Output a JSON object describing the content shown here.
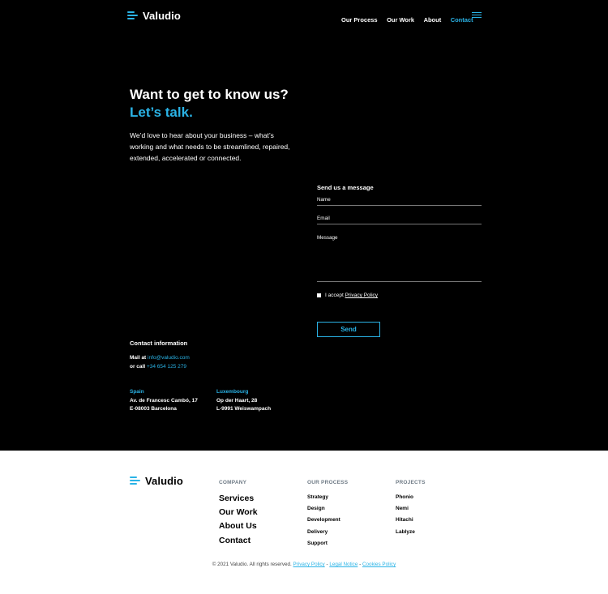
{
  "brand": {
    "name": "Valudio",
    "accent": "#2ab3e6"
  },
  "nav": {
    "items": [
      {
        "label": "Our Process"
      },
      {
        "label": "Our Work"
      },
      {
        "label": "About"
      },
      {
        "label": "Contact"
      }
    ],
    "menu_icon": "hamburger-icon"
  },
  "hero": {
    "title": "Want to get to know us?",
    "subtitle": "Let’s talk.",
    "intro": "We’d love to hear about your business – what’s working and what needs to be streamlined, repaired, extended, accelerated or connected."
  },
  "form": {
    "title": "Send us a message",
    "name_label": "Name",
    "email_label": "Email",
    "message_label": "Message",
    "accept_text": "I accept",
    "privacy_link": "Privacy Policy",
    "send_label": "Send"
  },
  "contact": {
    "heading": "Contact information",
    "mail_prefix": "Mail at",
    "email": "info@valudio.com",
    "call_prefix": "or call",
    "phone": "+34 654 125 279",
    "offices": [
      {
        "country": "Spain",
        "line1": "Av. de Francesc Cambó, 17",
        "line2": "E-08003 Barcelona"
      },
      {
        "country": "Luxembourg",
        "line1": "Op der Haart, 28",
        "line2": "L-9991 Weiswampach"
      }
    ]
  },
  "footer": {
    "company": {
      "heading": "COMPANY",
      "items": [
        "Services",
        "Our Work",
        "About Us",
        "Contact"
      ]
    },
    "process": {
      "heading": "OUR PROCESS",
      "items": [
        "Strategy",
        "Design",
        "Development",
        "Delivery",
        "Support"
      ]
    },
    "projects": {
      "heading": "PROJECTS",
      "items": [
        "Phonio",
        "Nemi",
        "Hitachi",
        "Lablyze"
      ]
    },
    "copyright": "© 2021 Valudio. All rights reserved.",
    "legal_links": [
      "Privacy Policy",
      "Legal Notice",
      "Cookies Policy"
    ],
    "separator": "-"
  }
}
